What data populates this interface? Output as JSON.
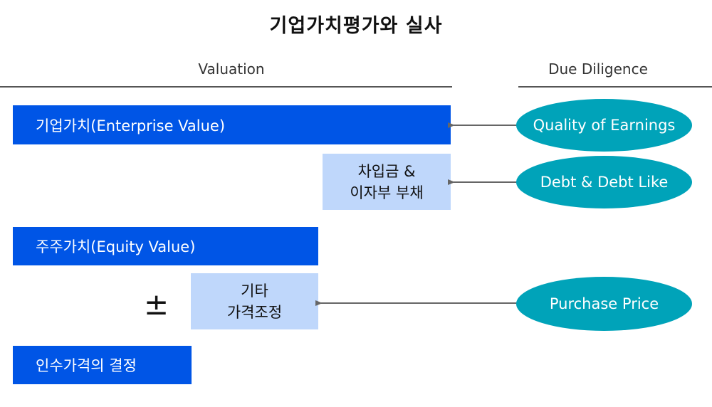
{
  "title": "기업가치평가와 실사",
  "headers": {
    "valuation": "Valuation",
    "due_diligence": "Due Diligence"
  },
  "valuation_boxes": {
    "enterprise_value": "기업가치(Enterprise Value)",
    "debt": [
      "차입금 &",
      "이자부 부채"
    ],
    "equity_value": "주주가치(Equity Value)",
    "plus_minus": "±",
    "other_adjustment": [
      "기타",
      "가격조정"
    ],
    "purchase_price_decision": "인수가격의 결정"
  },
  "due_diligence_items": {
    "quality_of_earnings": "Quality of Earnings",
    "debt_like": "Debt & Debt Like",
    "purchase_price": "Purchase Price"
  },
  "colors": {
    "primary_box": "#0055e6",
    "secondary_box": "#bfd7fb",
    "ellipse": "#00a3b9",
    "arrow": "#666666"
  }
}
